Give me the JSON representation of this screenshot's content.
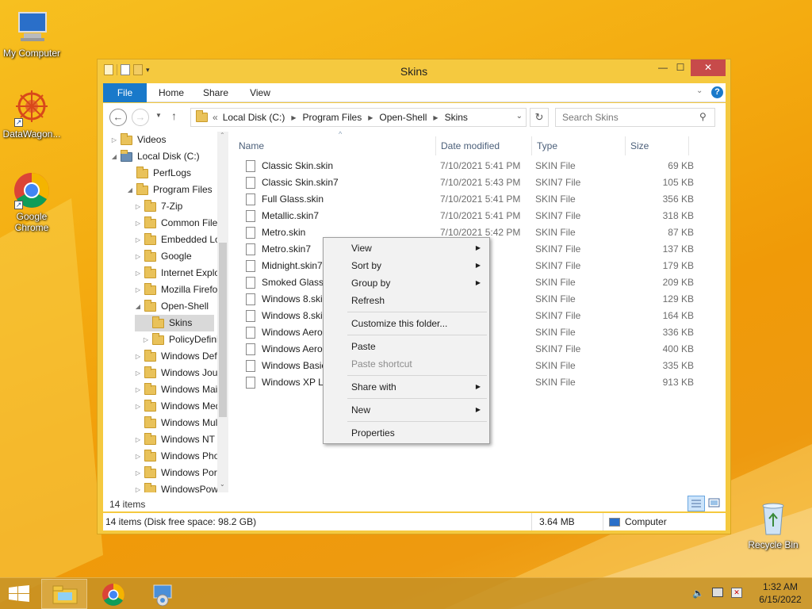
{
  "desktop": {
    "icons": [
      {
        "label": "My Computer",
        "icon": "computer-icon"
      },
      {
        "label": "DataWagon...",
        "icon": "datawagon-icon"
      },
      {
        "label": "Google Chrome",
        "icon": "chrome-icon"
      },
      {
        "label": "Recycle Bin",
        "icon": "recycle-bin-icon"
      }
    ]
  },
  "window": {
    "title": "Skins",
    "controls": {
      "minimize": "—",
      "maximize": "☐",
      "close": "✕"
    },
    "ribbon_tabs": [
      "File",
      "Home",
      "Share",
      "View"
    ],
    "address": {
      "prefix": "«",
      "crumbs": [
        "Local Disk (C:)",
        "Program Files",
        "Open-Shell",
        "Skins"
      ]
    },
    "search_placeholder": "Search Skins",
    "tree": [
      {
        "label": "Videos",
        "arrow": "▷",
        "level": 1
      },
      {
        "label": "Local Disk (C:)",
        "arrow": "◢",
        "level": 1,
        "drive": true
      },
      {
        "label": "PerfLogs",
        "arrow": "",
        "level": 2
      },
      {
        "label": "Program Files",
        "arrow": "◢",
        "level": 2
      },
      {
        "label": "7-Zip",
        "arrow": "▷",
        "level": 3
      },
      {
        "label": "Common Files",
        "arrow": "▷",
        "level": 3
      },
      {
        "label": "Embedded Lockdown Manager",
        "arrow": "▷",
        "level": 3
      },
      {
        "label": "Google",
        "arrow": "▷",
        "level": 3
      },
      {
        "label": "Internet Explorer",
        "arrow": "▷",
        "level": 3
      },
      {
        "label": "Mozilla Firefox",
        "arrow": "▷",
        "level": 3
      },
      {
        "label": "Open-Shell",
        "arrow": "◢",
        "level": 3
      },
      {
        "label": "Skins",
        "arrow": "",
        "level": 4,
        "selected": true
      },
      {
        "label": "PolicyDefinitions",
        "arrow": "▷",
        "level": 4
      },
      {
        "label": "Windows Defender",
        "arrow": "▷",
        "level": 3
      },
      {
        "label": "Windows Journal",
        "arrow": "▷",
        "level": 3
      },
      {
        "label": "Windows Mail",
        "arrow": "▷",
        "level": 3
      },
      {
        "label": "Windows Media Player",
        "arrow": "▷",
        "level": 3
      },
      {
        "label": "Windows Multimedia Platform",
        "arrow": "",
        "level": 3
      },
      {
        "label": "Windows NT",
        "arrow": "▷",
        "level": 3
      },
      {
        "label": "Windows Photo Viewer",
        "arrow": "▷",
        "level": 3
      },
      {
        "label": "Windows Portable Devices",
        "arrow": "▷",
        "level": 3
      },
      {
        "label": "WindowsPowerShell",
        "arrow": "▷",
        "level": 3
      }
    ],
    "columns": {
      "name": "Name",
      "date": "Date modified",
      "type": "Type",
      "size": "Size"
    },
    "files": [
      {
        "name": "Classic Skin.skin",
        "date": "7/10/2021 5:41 PM",
        "type": "SKIN File",
        "size": "69 KB"
      },
      {
        "name": "Classic Skin.skin7",
        "date": "7/10/2021 5:43 PM",
        "type": "SKIN7 File",
        "size": "105 KB"
      },
      {
        "name": "Full Glass.skin",
        "date": "7/10/2021 5:41 PM",
        "type": "SKIN File",
        "size": "356 KB"
      },
      {
        "name": "Metallic.skin7",
        "date": "7/10/2021 5:41 PM",
        "type": "SKIN7 File",
        "size": "318 KB"
      },
      {
        "name": "Metro.skin",
        "date": "7/10/2021 5:42 PM",
        "type": "SKIN File",
        "size": "87 KB"
      },
      {
        "name": "Metro.skin7",
        "date": "5:43 PM",
        "type": "SKIN7 File",
        "size": "137 KB"
      },
      {
        "name": "Midnight.skin7",
        "date": "5:43 PM",
        "type": "SKIN7 File",
        "size": "179 KB"
      },
      {
        "name": "Smoked Glass.s",
        "date": "5:41 PM",
        "type": "SKIN File",
        "size": "209 KB"
      },
      {
        "name": "Windows 8.skin",
        "date": "5:43 PM",
        "type": "SKIN File",
        "size": "129 KB"
      },
      {
        "name": "Windows 8.skin",
        "date": "5:42 PM",
        "type": "SKIN7 File",
        "size": "164 KB"
      },
      {
        "name": "Windows Aero.",
        "date": "5:41 PM",
        "type": "SKIN File",
        "size": "336 KB"
      },
      {
        "name": "Windows Aero.",
        "date": "5:43 PM",
        "type": "SKIN7 File",
        "size": "400 KB"
      },
      {
        "name": "Windows Basic",
        "date": "5:41 PM",
        "type": "SKIN File",
        "size": "335 KB"
      },
      {
        "name": "Windows XP Lu",
        "date": "5:41 PM",
        "type": "SKIN File",
        "size": "913 KB"
      }
    ],
    "item_count": "14 items",
    "status": {
      "left": "14 items (Disk free space: 98.2 GB)",
      "size": "3.64 MB",
      "location": "Computer"
    }
  },
  "context_menu": [
    {
      "label": "View",
      "submenu": true
    },
    {
      "label": "Sort by",
      "submenu": true
    },
    {
      "label": "Group by",
      "submenu": true
    },
    {
      "label": "Refresh"
    },
    {
      "sep": true
    },
    {
      "label": "Customize this folder..."
    },
    {
      "sep": true
    },
    {
      "label": "Paste"
    },
    {
      "label": "Paste shortcut",
      "disabled": true
    },
    {
      "sep": true
    },
    {
      "label": "Share with",
      "submenu": true
    },
    {
      "sep": true
    },
    {
      "label": "New",
      "submenu": true
    },
    {
      "sep": true
    },
    {
      "label": "Properties"
    }
  ],
  "taskbar": {
    "time": "1:32 AM",
    "date": "6/15/2022",
    "buttons": [
      "start-button",
      "file-explorer-button",
      "chrome-button",
      "control-panel-button"
    ]
  }
}
